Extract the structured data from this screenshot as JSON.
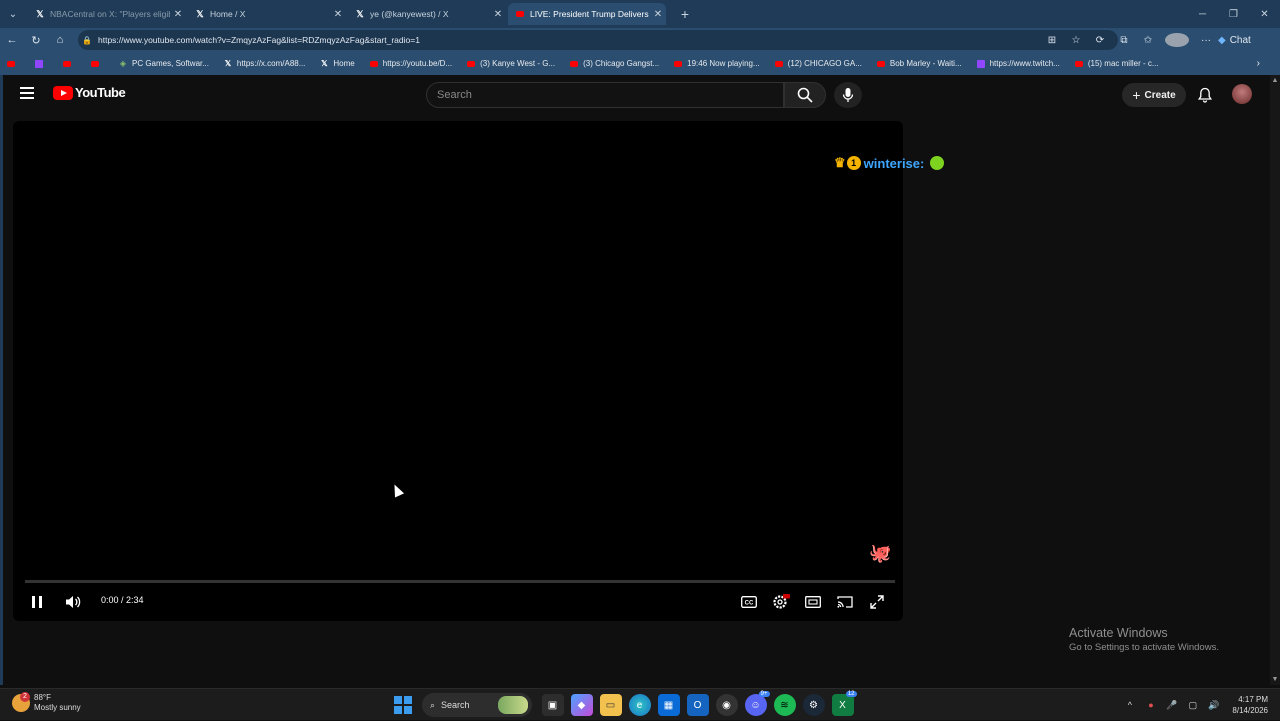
{
  "browser": {
    "tabs": [
      {
        "title": "NBACentral on X: \"Players eligible",
        "icon": "x-icon",
        "state": "faded"
      },
      {
        "title": "Home / X",
        "icon": "x-icon",
        "state": "normal"
      },
      {
        "title": "ye (@kanyewest) / X",
        "icon": "x-icon",
        "state": "normal"
      },
      {
        "title": "LIVE: President Trump Delivers Re",
        "icon": "youtube-icon",
        "state": "active"
      }
    ],
    "url": "https://www.youtube.com/watch?v=ZmqyzAzFag&list=RDZmqyzAzFag&start_radio=1",
    "chat_label": "Chat",
    "bookmarks": [
      {
        "label": "",
        "icon": "youtube-icon"
      },
      {
        "label": "",
        "icon": "twitch-icon"
      },
      {
        "label": "",
        "icon": "youtube-icon"
      },
      {
        "label": "",
        "icon": "youtube-icon"
      },
      {
        "label": "PC Games, Softwar...",
        "icon": "games-icon"
      },
      {
        "label": "https://x.com/A88...",
        "icon": "x-icon"
      },
      {
        "label": "Home",
        "icon": "x-icon"
      },
      {
        "label": "https://youtu.be/D...",
        "icon": "youtube-icon"
      },
      {
        "label": "(3) Kanye West - G...",
        "icon": "youtube-icon"
      },
      {
        "label": "(3) Chicago Gangst...",
        "icon": "youtube-icon"
      },
      {
        "label": "19:46 Now playing...",
        "icon": "youtube-icon"
      },
      {
        "label": "(12) CHICAGO GA...",
        "icon": "youtube-icon"
      },
      {
        "label": "Bob Marley - Waiti...",
        "icon": "youtube-icon"
      },
      {
        "label": "https://www.twitch...",
        "icon": "twitch-icon"
      },
      {
        "label": "(15) mac miller - c...",
        "icon": "youtube-icon"
      }
    ]
  },
  "youtube": {
    "logo_text": "YouTube",
    "search_placeholder": "Search",
    "create_label": "Create",
    "player": {
      "current_time": "0:00 / 2:34",
      "progress_fraction": 0,
      "overlay_username": "winterise:"
    }
  },
  "watermark": {
    "line1": "Activate Windows",
    "line2": "Go to Settings to activate Windows."
  },
  "taskbar": {
    "weather_temp": "88°F",
    "weather_desc": "Mostly sunny",
    "weather_badge": "2",
    "search_label": "Search",
    "time": "4:17 PM",
    "date": "8/14/2026"
  },
  "colors": {
    "tabbar": "#1f3b57",
    "toolbar": "#2b4e70",
    "youtube_red": "#ff0000",
    "page_bg": "#0f0f0f",
    "username_blue": "#3ea6ff"
  }
}
